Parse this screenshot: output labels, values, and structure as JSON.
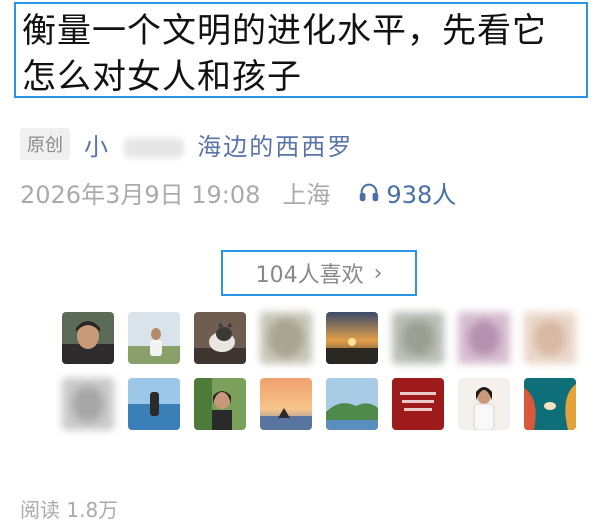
{
  "article": {
    "title": "衡量一个文明的进化水平，先看它怎么对女人和孩子",
    "original_badge": "原创",
    "author_prefix": "小",
    "author_suffix": "海边的西西罗",
    "date": "2026年3月9日 19:08",
    "location": "上海",
    "listen_count": "938人"
  },
  "likes": {
    "label": "104人喜欢",
    "chevron": "›"
  },
  "reads": {
    "label": "阅读 1.8万"
  },
  "icons": {
    "listen": "headphones-icon",
    "chevron": "chevron-right-icon"
  },
  "colors": {
    "highlight_border": "#2a94e6",
    "author": "#5a74a8",
    "listen": "#4a6fa5",
    "muted": "#aaaaaa"
  }
}
